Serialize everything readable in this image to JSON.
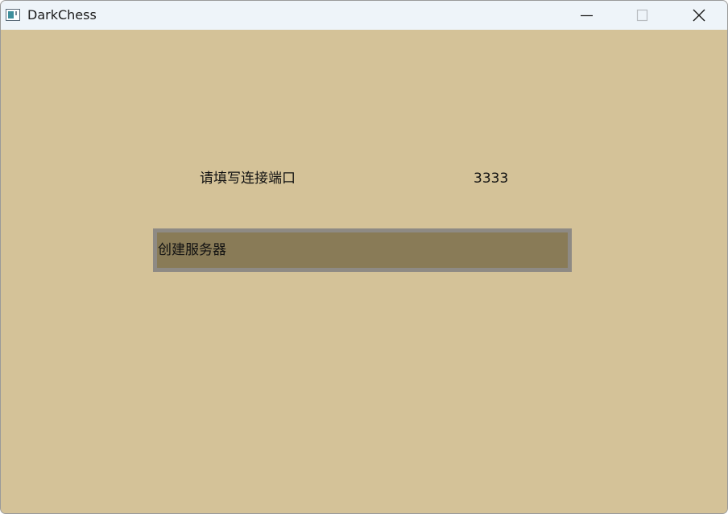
{
  "window": {
    "title": "DarkChess",
    "icon": "app-window-icon",
    "controls": {
      "minimize": "minimize-icon",
      "maximize": "maximize-icon",
      "close": "close-icon"
    }
  },
  "form": {
    "port_label": "请填写连接端口",
    "port_value": "3333",
    "create_server_label": "创建服务器"
  },
  "colors": {
    "background": "#d4c298",
    "button_fill": "#897b57",
    "button_border": "#8e8a84",
    "titlebar": "#eef4f9"
  }
}
